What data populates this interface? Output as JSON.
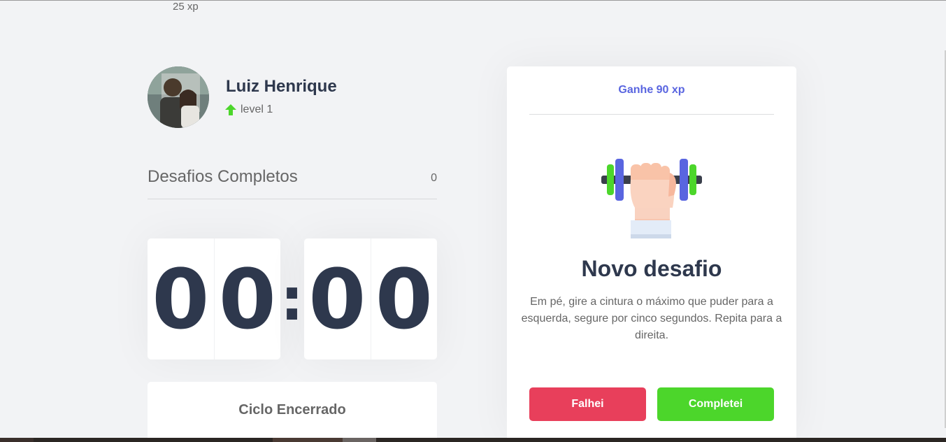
{
  "header": {
    "xp": "25 xp"
  },
  "profile": {
    "name": "Luiz Henrique",
    "level": "level 1",
    "level_icon": "level-up-arrow-icon"
  },
  "completed": {
    "label": "Desafios Completos",
    "count": "0"
  },
  "countdown": {
    "minutes": [
      "0",
      "0"
    ],
    "separator": ":",
    "seconds": [
      "0",
      "0"
    ]
  },
  "cycle": {
    "button_label": "Ciclo Encerrado"
  },
  "challenge": {
    "xp_gain": "Ganhe 90 xp",
    "icon": "dumbbell-icon",
    "title": "Novo desafio",
    "description": "Em pé, gire a cintura o máximo que puder para a esquerda, segure por cinco segundos. Repita para a direita.",
    "fail_label": "Falhei",
    "success_label": "Completei"
  },
  "colors": {
    "background": "#f2f3f5",
    "title": "#2e384d",
    "text": "#666666",
    "blue": "#5965e0",
    "red": "#e83f5b",
    "green": "#4cd62b"
  }
}
